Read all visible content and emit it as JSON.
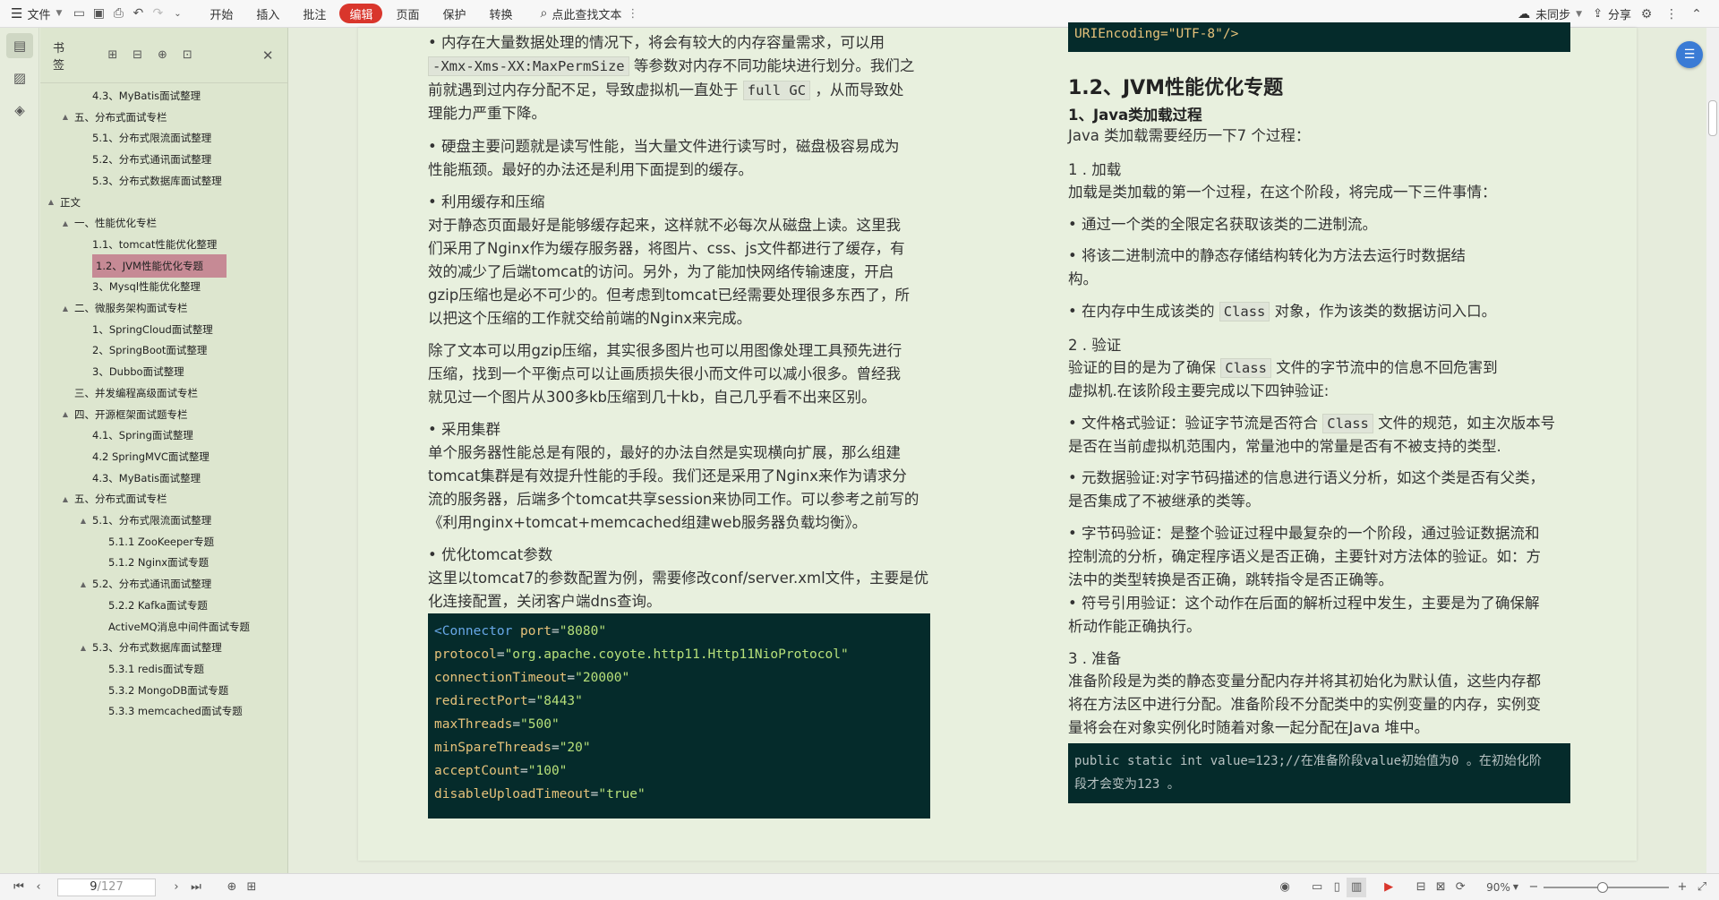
{
  "menubar": {
    "file_label": "文件",
    "tabs": [
      "开始",
      "插入",
      "批注",
      "编辑",
      "页面",
      "保护",
      "转换"
    ],
    "active_tab": "编辑",
    "search_label": "点此查找文本",
    "sync_label": "未同步",
    "share_label": "分享"
  },
  "bookmarks": {
    "title": "书签",
    "items": [
      {
        "label": "4.3、MyBatis面试整理",
        "level": 3,
        "twisty": ""
      },
      {
        "label": "五、分布式面试专栏",
        "level": 2,
        "twisty": "▲"
      },
      {
        "label": "5.1、分布式限流面试整理",
        "level": 3,
        "twisty": ""
      },
      {
        "label": "5.2、分布式通讯面试整理",
        "level": 3,
        "twisty": ""
      },
      {
        "label": "5.3、分布式数据库面试整理",
        "level": 3,
        "twisty": ""
      },
      {
        "label": "正文",
        "level": 1,
        "twisty": "▲"
      },
      {
        "label": "一、性能优化专栏",
        "level": 2,
        "twisty": "▲"
      },
      {
        "label": "1.1、tomcat性能优化整理",
        "level": 3,
        "twisty": ""
      },
      {
        "label": "1.2、JVM性能优化专题",
        "level": 3,
        "twisty": "",
        "selected": true
      },
      {
        "label": "3、Mysql性能优化整理",
        "level": 3,
        "twisty": ""
      },
      {
        "label": "二、微服务架构面试专栏",
        "level": 2,
        "twisty": "▲"
      },
      {
        "label": "1、SpringCloud面试整理",
        "level": 3,
        "twisty": ""
      },
      {
        "label": "2、SpringBoot面试整理",
        "level": 3,
        "twisty": ""
      },
      {
        "label": "3、Dubbo面试整理",
        "level": 3,
        "twisty": ""
      },
      {
        "label": "三、并发编程高级面试专栏",
        "level": 2,
        "twisty": ""
      },
      {
        "label": "四、开源框架面试题专栏",
        "level": 2,
        "twisty": "▲"
      },
      {
        "label": "4.1、Spring面试整理",
        "level": 3,
        "twisty": ""
      },
      {
        "label": "4.2 SpringMVC面试整理",
        "level": 3,
        "twisty": ""
      },
      {
        "label": "4.3、MyBatis面试整理",
        "level": 3,
        "twisty": ""
      },
      {
        "label": "五、分布式面试专栏",
        "level": 2,
        "twisty": "▲"
      },
      {
        "label": "5.1、分布式限流面试整理",
        "level": 3,
        "twisty": "▲"
      },
      {
        "label": "5.1.1 ZooKeeper专题",
        "level": 4,
        "twisty": ""
      },
      {
        "label": "5.1.2 Nginx面试专题",
        "level": 4,
        "twisty": ""
      },
      {
        "label": "5.2、分布式通讯面试整理",
        "level": 3,
        "twisty": "▲"
      },
      {
        "label": "5.2.2 Kafka面试专题",
        "level": 4,
        "twisty": ""
      },
      {
        "label": "ActiveMQ消息中间件面试专题",
        "level": 4,
        "twisty": ""
      },
      {
        "label": "5.3、分布式数据库面试整理",
        "level": 3,
        "twisty": "▲"
      },
      {
        "label": "5.3.1 redis面试专题",
        "level": 4,
        "twisty": ""
      },
      {
        "label": "5.3.2 MongoDB面试专题",
        "level": 4,
        "twisty": ""
      },
      {
        "label": "5.3.3 memcached面试专题",
        "level": 4,
        "twisty": ""
      }
    ]
  },
  "doc_left": {
    "p1a": "• 内存在大量数据处理的情况下，将会有较大的内存容量需求，可以用",
    "p1b_code": "-Xmx-Xms-XX:MaxPermSize",
    "p1b_rest": " 等参数对内存不同功能块进行划分。我们之",
    "p1c_pre": "前就遇到过内存分配不足，导致虚拟机一直处于 ",
    "p1c_code": "full GC",
    "p1c_post": " ，从而导致处",
    "p1d": "理能力严重下降。",
    "p2a": "• 硬盘主要问题就是读写性能，当大量文件进行读写时，磁盘极容易成为",
    "p2b": "性能瓶颈。最好的办法还是利用下面提到的缓存。",
    "p3a": "• 利用缓存和压缩",
    "p3b": "对于静态页面最好是能够缓存起来，这样就不必每次从磁盘上读。这里我",
    "p3c": "们采用了Nginx作为缓存服务器，将图片、css、js文件都进行了缓存，有",
    "p3d": "效的减少了后端tomcat的访问。另外，为了能加快网络传输速度，开启",
    "p3e": "gzip压缩也是必不可少的。但考虑到tomcat已经需要处理很多东西了，所",
    "p3f": "以把这个压缩的工作就交给前端的Nginx来完成。",
    "p4a": "除了文本可以用gzip压缩，其实很多图片也可以用图像处理工具预先进行",
    "p4b": "压缩，找到一个平衡点可以让画质损失很小而文件可以减小很多。曾经我",
    "p4c": "就见过一个图片从300多kb压缩到几十kb，自己几乎看不出来区别。",
    "p5a": "• 采用集群",
    "p5b": "单个服务器性能总是有限的，最好的办法自然是实现横向扩展，那么组建",
    "p5c": "tomcat集群是有效提升性能的手段。我们还是采用了Nginx来作为请求分",
    "p5d": "流的服务器，后端多个tomcat共享session来协同工作。可以参考之前写的",
    "p5e": "《利用nginx+tomcat+memcached组建web服务器负载均衡》。",
    "p6a": "• 优化tomcat参数",
    "p6b": "这里以tomcat7的参数配置为例，需要修改conf/server.xml文件，主要是优",
    "p6c": "化连接配置，关闭客户端dns查询。"
  },
  "code_left": [
    {
      "a": "port",
      "v": "\"8080\"",
      "k": "<Connector"
    },
    {
      "a": "protocol",
      "v": "\"org.apache.coyote.http11.Http11NioProtocol\""
    },
    {
      "a": "connectionTimeout",
      "v": "\"20000\""
    },
    {
      "a": "redirectPort",
      "v": "\"8443\""
    },
    {
      "a": "maxThreads",
      "v": "\"500\""
    },
    {
      "a": "minSpareThreads",
      "v": "\"20\""
    },
    {
      "a": "acceptCount",
      "v": "\"100\""
    },
    {
      "a": "disableUploadTimeout",
      "v": "\"true\""
    }
  ],
  "doc_right": {
    "code_top": "URIEncoding=\"UTF-8\"/>",
    "h2": "1.2、JVM性能优化专题",
    "h3": "1、Java类加载过程",
    "intro": "Java 类加载需要经历一下7 个过程：",
    "s1": "1 . 加载",
    "s1t": "加载是类加载的第一个过程，在这个阶段，将完成一下三件事情：",
    "b1": "• 通过一个类的全限定名获取该类的二进制流。",
    "b2a": "• 将该二进制流中的静态存储结构转化为方法去运行时数据结",
    "b2b": "构。",
    "b3_pre": "• 在内存中生成该类的 ",
    "b3_code": "Class",
    "b3_post": " 对象，作为该类的数据访问入口。",
    "s2": "2 . 验证",
    "s2a_pre": "验证的目的是为了确保 ",
    "s2a_code": "Class",
    "s2a_post": " 文件的字节流中的信息不回危害到",
    "s2b": "虚拟机.在该阶段主要完成以下四钟验证:",
    "v1a_pre": "• 文件格式验证：验证字节流是否符合 ",
    "v1a_code": "Class",
    "v1a_post": " 文件的规范，如主次版本号",
    "v1b": "是否在当前虚拟机范围内，常量池中的常量是否有不被支持的类型.",
    "v2a": "• 元数据验证:对字节码描述的信息进行语义分析，如这个类是否有父类，",
    "v2b": "是否集成了不被继承的类等。",
    "v3a": "• 字节码验证：是整个验证过程中最复杂的一个阶段，通过验证数据流和",
    "v3b": "控制流的分析，确定程序语义是否正确，主要针对方法体的验证。如：方",
    "v3c": "法中的类型转换是否正确，跳转指令是否正确等。",
    "v4a": "• 符号引用验证：这个动作在后面的解析过程中发生，主要是为了确保解",
    "v4b": "析动作能正确执行。",
    "s3": "3 . 准备",
    "s3a": "准备阶段是为类的静态变量分配内存并将其初始化为默认值，这些内存都",
    "s3b": "将在方法区中进行分配。准备阶段不分配类中的实例变量的内存，实例变",
    "s3c": "量将会在对象实例化时随着对象一起分配在Java 堆中。",
    "code2a": "public static int value=123;//在准备阶段value初始值为0 。在初始化阶",
    "code2b": "段才会变为123 。"
  },
  "status": {
    "page_current": "9",
    "page_total": "/127",
    "zoom": "90%"
  },
  "colors": {
    "active_tab": "#d9362c",
    "selected_bookmark": "#c68a95",
    "code_bg": "#052b2b"
  }
}
